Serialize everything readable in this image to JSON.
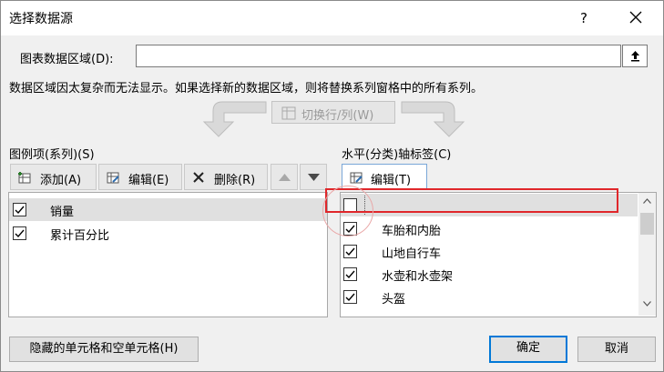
{
  "window": {
    "title": "选择数据源"
  },
  "titlebar": {
    "help_label": "?",
    "close_icon": "close-icon"
  },
  "range": {
    "label": "图表数据区域(D):",
    "value": ""
  },
  "warning": "数据区域因太复杂而无法显示。如果选择新的数据区域，则将替换系列窗格中的所有系列。",
  "switch_button": {
    "label": "切换行/列(W)"
  },
  "legend_panel": {
    "title": "图例项(系列)(S)",
    "add_label": "添加(A)",
    "edit_label": "编辑(E)",
    "delete_label": "删除(R)",
    "items": [
      {
        "label": "销量",
        "checked": true
      },
      {
        "label": "累计百分比",
        "checked": true
      }
    ]
  },
  "axis_panel": {
    "title": "水平(分类)轴标签(C)",
    "edit_label": "编辑(T)",
    "items": [
      {
        "label": "",
        "checked": false
      },
      {
        "label": "车胎和内胎",
        "checked": true
      },
      {
        "label": "山地自行车",
        "checked": true
      },
      {
        "label": "水壶和水壶架",
        "checked": true
      },
      {
        "label": "头盔",
        "checked": true
      }
    ]
  },
  "footer": {
    "hidden_cells_label": "隐藏的单元格和空单元格(H)",
    "ok_label": "确定",
    "cancel_label": "取消"
  },
  "colors": {
    "highlight": "#e0272b",
    "accent": "#0078d7"
  }
}
